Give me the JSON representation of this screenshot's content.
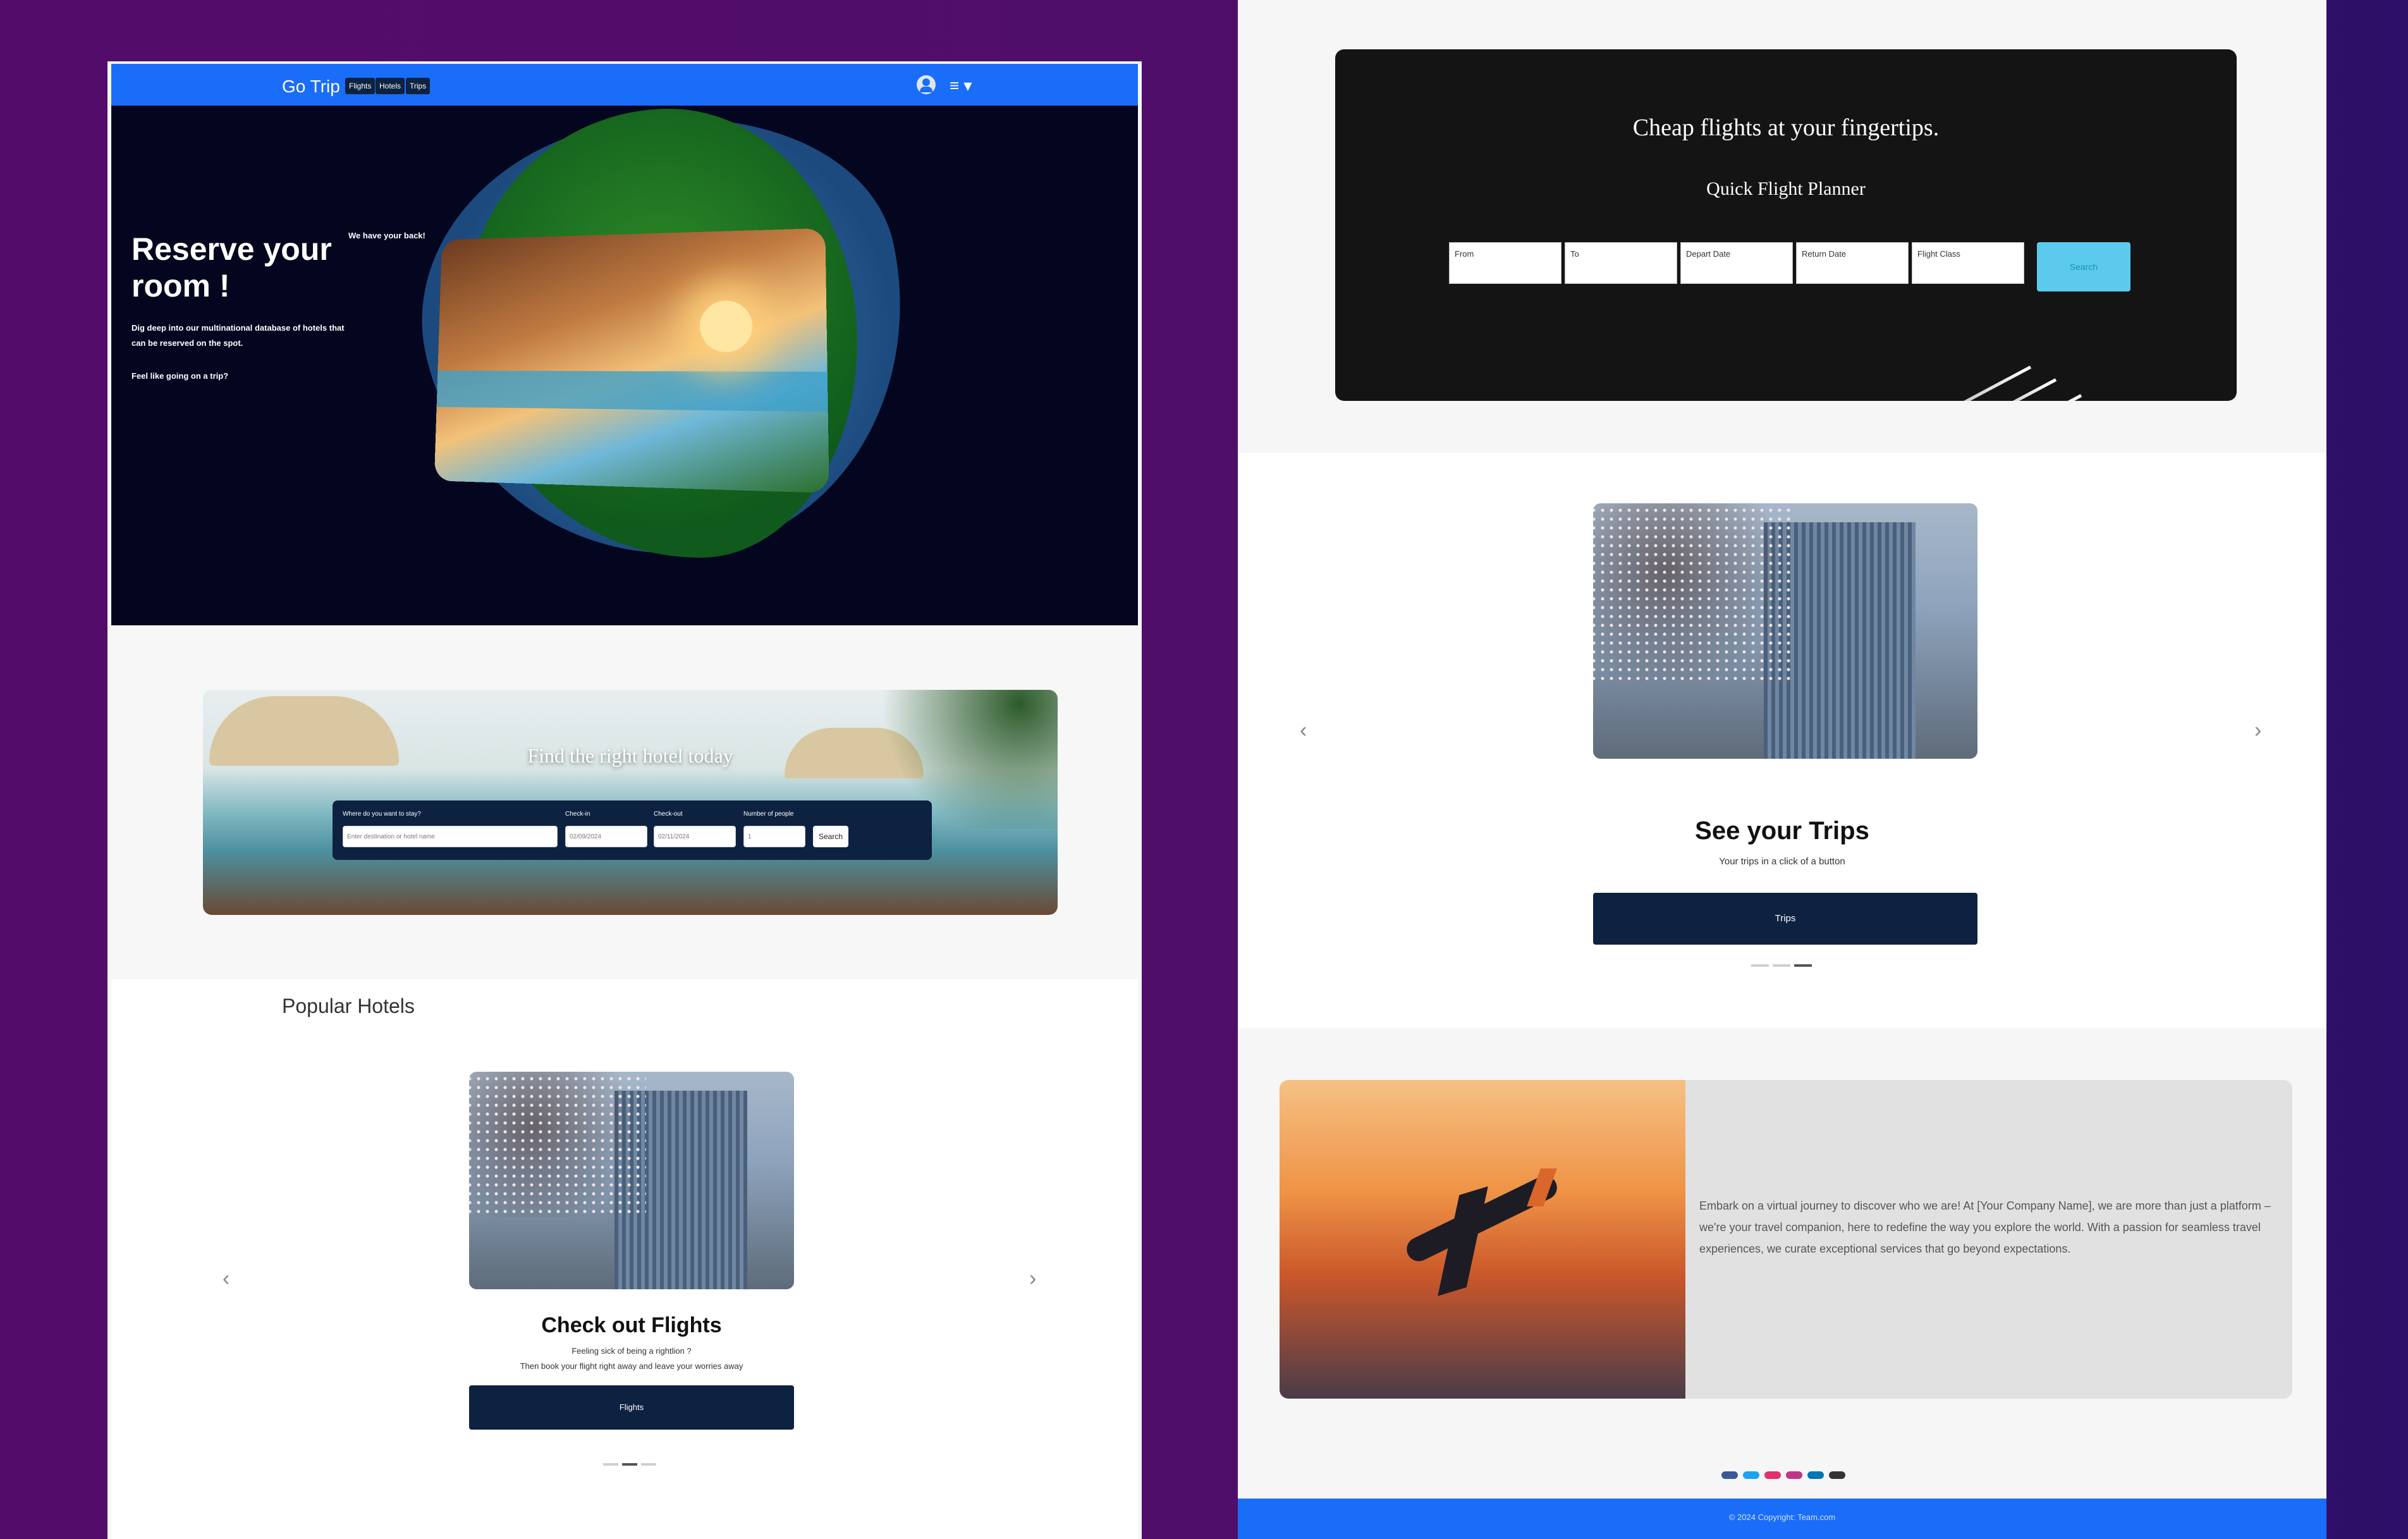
{
  "left_page": {
    "nav": {
      "brand": "Go Trip",
      "links": [
        "Flights",
        "Hotels",
        "Trips"
      ],
      "menu_glyph": "≡ ▾",
      "icons": [
        "user-icon",
        "menu-icon"
      ]
    },
    "hero": {
      "title": "Reserve your room !",
      "description": "Dig deep into our multinational database of hotels that can be reserved on the spot.",
      "prompt": "Feel like going on a trip?",
      "tagline": "We have your back!"
    },
    "hotel_search": {
      "banner_title": "Find the right hotel today",
      "labels": {
        "destination": "Where do you want to stay?",
        "checkin": "Check-in",
        "checkout": "Check-out",
        "people": "Number of people"
      },
      "destination_placeholder": "Enter destination or hotel name",
      "checkin_value": "02/09/2024",
      "checkout_value": "02/11/2024",
      "people_value": "1",
      "search_label": "Search"
    },
    "popular": {
      "title": "Popular Hotels",
      "slide_heading": "Check out Flights",
      "slide_line1": "Feeling sick of being a rightlion ?",
      "slide_line2": "Then book your flight right away and leave your worries away",
      "button_label": "Flights",
      "prev_arrow": "‹",
      "next_arrow": "›"
    }
  },
  "right_page": {
    "flight_planner": {
      "title": "Cheap flights at your fingertips.",
      "subtitle": "Quick Flight Planner",
      "fields": [
        "From",
        "To",
        "Depart Date",
        "Return Date",
        "Flight Class"
      ],
      "search_label": "Search"
    },
    "trips": {
      "heading": "See your Trips",
      "subtitle": "Your trips in a click of a button",
      "button_label": "Trips",
      "prev_arrow": "‹",
      "next_arrow": "›"
    },
    "about": {
      "text": "Embark on a virtual journey to discover who we are! At [Your Company Name], we are more than just a platform – we're your travel companion, here to redefine the way you explore the world. With a passion for seamless travel experiences, we curate exceptional services that go beyond expectations."
    },
    "social_colors": [
      "#3b5998",
      "#1da1f2",
      "#e1306c",
      "#c13584",
      "#0077b5",
      "#333333"
    ],
    "footer": {
      "text": "© 2024 Copyright: Team.com"
    }
  },
  "colors": {
    "primary_blue": "#1a6df8",
    "navy": "#0d2140",
    "hero_bg": "#04061f",
    "search_accent": "#5ccaec",
    "background_purple": "#540c6a"
  }
}
